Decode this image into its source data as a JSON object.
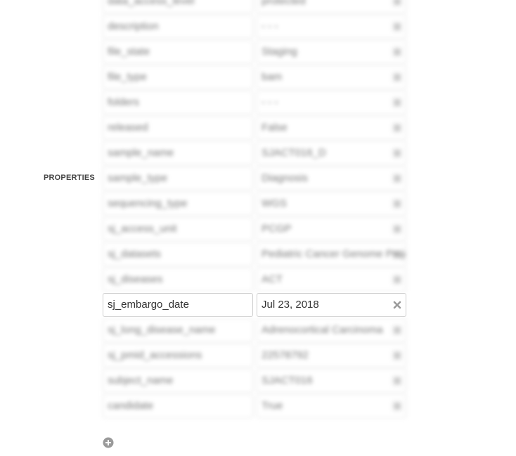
{
  "section": {
    "label": "PROPERTIES"
  },
  "properties": [
    {
      "key": "data_access_level",
      "value": "protected",
      "blurred": true
    },
    {
      "key": "description",
      "value": "- - -",
      "blurred": true
    },
    {
      "key": "file_state",
      "value": "Staging",
      "blurred": true
    },
    {
      "key": "file_type",
      "value": "bam",
      "blurred": true
    },
    {
      "key": "folders",
      "value": "- - -",
      "blurred": true
    },
    {
      "key": "released",
      "value": "False",
      "blurred": true
    },
    {
      "key": "sample_name",
      "value": "SJACT016_D",
      "blurred": true
    },
    {
      "key": "sample_type",
      "value": "Diagnosis",
      "blurred": true
    },
    {
      "key": "sequencing_type",
      "value": "WGS",
      "blurred": true
    },
    {
      "key": "sj_access_unit",
      "value": "PCGP",
      "blurred": true
    },
    {
      "key": "sj_datasets",
      "value": "Pediatric Cancer Genome Project",
      "blurred": true
    },
    {
      "key": "sj_diseases",
      "value": "ACT",
      "blurred": true
    },
    {
      "key": "sj_embargo_date",
      "value": "Jul 23, 2018",
      "blurred": false
    },
    {
      "key": "sj_long_disease_name",
      "value": "Adrenocortical Carcinoma",
      "blurred": true
    },
    {
      "key": "sj_pmid_accessions",
      "value": "22578792",
      "blurred": true
    },
    {
      "key": "subject_name",
      "value": "SJACT016",
      "blurred": true
    },
    {
      "key": "candidate",
      "value": "True",
      "blurred": true
    }
  ],
  "icons": {
    "remove": "close-x-icon",
    "add": "add-circle-icon"
  },
  "colors": {
    "border": "#cfcfcf",
    "text": "#333333",
    "icon": "#9a9a9a"
  }
}
